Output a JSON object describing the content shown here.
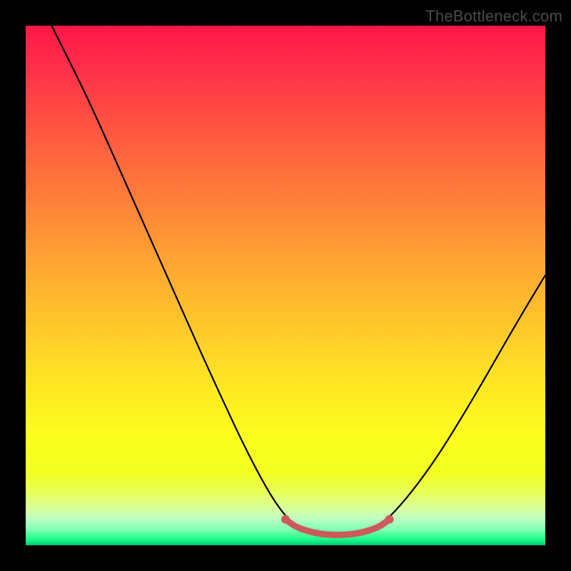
{
  "watermark": "TheBottleneck.com",
  "chart_data": {
    "type": "line",
    "title": "",
    "xlabel": "",
    "ylabel": "",
    "xlim": [
      0,
      1
    ],
    "ylim": [
      0,
      1
    ],
    "series": [
      {
        "name": "curve",
        "points": [
          {
            "x": 0.05,
            "y": 1.0
          },
          {
            "x": 0.12,
            "y": 0.86
          },
          {
            "x": 0.2,
            "y": 0.68
          },
          {
            "x": 0.28,
            "y": 0.5
          },
          {
            "x": 0.36,
            "y": 0.32
          },
          {
            "x": 0.44,
            "y": 0.15
          },
          {
            "x": 0.5,
            "y": 0.05
          },
          {
            "x": 0.55,
            "y": 0.02
          },
          {
            "x": 0.6,
            "y": 0.02
          },
          {
            "x": 0.65,
            "y": 0.02
          },
          {
            "x": 0.7,
            "y": 0.05
          },
          {
            "x": 0.78,
            "y": 0.15
          },
          {
            "x": 0.86,
            "y": 0.28
          },
          {
            "x": 0.94,
            "y": 0.42
          },
          {
            "x": 1.0,
            "y": 0.52
          }
        ]
      },
      {
        "name": "highlight",
        "stroke": "#cc5a5a",
        "stroke_width": 9,
        "points": [
          {
            "x": 0.5,
            "y": 0.05
          },
          {
            "x": 0.52,
            "y": 0.035
          },
          {
            "x": 0.55,
            "y": 0.025
          },
          {
            "x": 0.58,
            "y": 0.02
          },
          {
            "x": 0.62,
            "y": 0.02
          },
          {
            "x": 0.65,
            "y": 0.025
          },
          {
            "x": 0.68,
            "y": 0.035
          },
          {
            "x": 0.7,
            "y": 0.05
          }
        ]
      }
    ],
    "markers": [
      {
        "x": 0.5,
        "y": 0.05,
        "r": 6,
        "fill": "#cc5a5a"
      },
      {
        "x": 0.7,
        "y": 0.05,
        "r": 6,
        "fill": "#cc5a5a"
      }
    ]
  }
}
